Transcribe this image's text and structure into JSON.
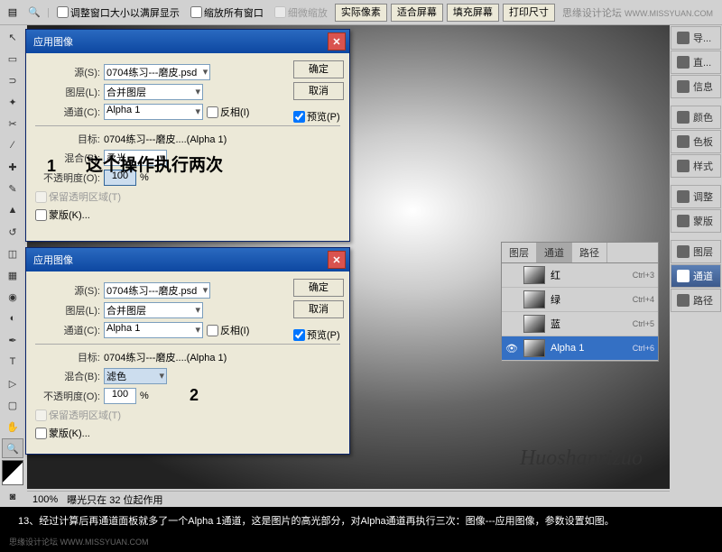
{
  "watermark": {
    "top_label": "思缘设计论坛",
    "top_url": "WWW.MISSYUAN.COM",
    "bottom": "思缘设计论坛 WWW.MISSYUAN.COM"
  },
  "topbar": {
    "check1": "调整窗口大小以满屏显示",
    "check2": "缩放所有窗口",
    "check3": "细微缩放",
    "btn1": "实际像素",
    "btn2": "适合屏幕",
    "btn3": "填充屏幕",
    "btn4": "打印尺寸"
  },
  "dialog": {
    "title": "应用图像",
    "source_label": "源(S):",
    "source_value": "0704练习---磨皮.psd",
    "layer_label": "图层(L):",
    "layer_value": "合并图层",
    "channel_label": "通道(C):",
    "channel_value": "Alpha 1",
    "invert": "反相(I)",
    "target_label": "目标:",
    "target_value": "0704练习---磨皮....(Alpha 1)",
    "blend_label": "混合(B):",
    "blend1": "柔光",
    "blend2": "滤色",
    "opacity_label": "不透明度(O):",
    "opacity_value": "100",
    "opacity_unit": "%",
    "preserve_trans": "保留透明区域(T)",
    "mask": "蒙版(K)...",
    "ok": "确定",
    "cancel": "取消",
    "preview": "预览(P)"
  },
  "annotations": {
    "num1": "1",
    "text1": "这个操作执行两次",
    "num2": "2"
  },
  "channels": {
    "tab_layers": "图层",
    "tab_channels": "通道",
    "tab_paths": "路径",
    "rows": [
      {
        "name": "红",
        "shortcut": "Ctrl+3"
      },
      {
        "name": "绿",
        "shortcut": "Ctrl+4"
      },
      {
        "name": "蓝",
        "shortcut": "Ctrl+5"
      },
      {
        "name": "Alpha 1",
        "shortcut": "Ctrl+6"
      }
    ]
  },
  "right_panels": [
    {
      "label": "导..."
    },
    {
      "label": "直..."
    },
    {
      "label": "信息"
    },
    {
      "label": "颜色"
    },
    {
      "label": "色板"
    },
    {
      "label": "样式"
    },
    {
      "label": "调整"
    },
    {
      "label": "蒙版"
    },
    {
      "label": "图层"
    },
    {
      "label": "通道"
    },
    {
      "label": "路径"
    }
  ],
  "status": {
    "zoom": "100%",
    "info": "曝光只在 32 位起作用"
  },
  "tutorial": "13、经过计算后再通道面板就多了一个Alpha 1通道，这是图片的高光部分，对Alpha通道再执行三次：图像---应用图像，参数设置如图。",
  "signature": "Huoshanrizuo"
}
